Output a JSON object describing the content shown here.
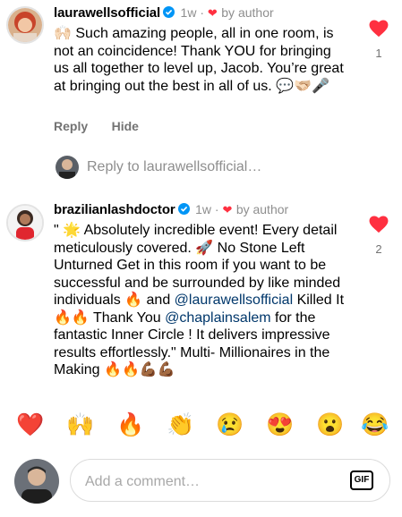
{
  "comments": [
    {
      "username": "laurawellsofficial",
      "time": "1w",
      "author_label": "by author",
      "text": "🙌🏻 Such amazing people, all in one room, is not an coincidence! Thank YOU for bringing us all together to level up, Jacob. You’re great at bringing out the best in all of us. 💬🫱🏻‍🫲🏼🎤",
      "likes": "1",
      "actions": [
        "Reply",
        "Hide"
      ]
    },
    {
      "username": "brazilianlashdoctor",
      "time": "1w",
      "author_label": "by author",
      "text_1": "\" 🌟 Absolutely incredible event! Every detail meticulously covered. 🚀 No Stone Left Unturned Get in this room if you want to be successful and be surrounded by like minded individuals 🔥 and ",
      "mention_1": "@laurawellsofficial",
      "text_2": " Killed It 🔥🔥 Thank You ",
      "mention_2": "@chaplainsalem",
      "text_3": " for the fantastic Inner Circle ! It delivers impressive results effortlessly.\" Multi- Millionaires in the Making 🔥🔥💪🏾💪🏾",
      "likes": "2"
    }
  ],
  "reply_prompt": "Reply to laurawellsofficial…",
  "emoji_bar": [
    "❤️",
    "🙌",
    "🔥",
    "👏",
    "😢",
    "😍",
    "😮",
    "😂"
  ],
  "comment_input": {
    "placeholder": "Add a comment…"
  },
  "gif_label": "GIF",
  "colors": {
    "heart": "#ff3040",
    "verified": "#0095f6",
    "mention": "#00376b",
    "gray": "#8e8e8e"
  },
  "icons": [
    "verified-badge-icon",
    "red-heart-icon",
    "gif-icon"
  ]
}
